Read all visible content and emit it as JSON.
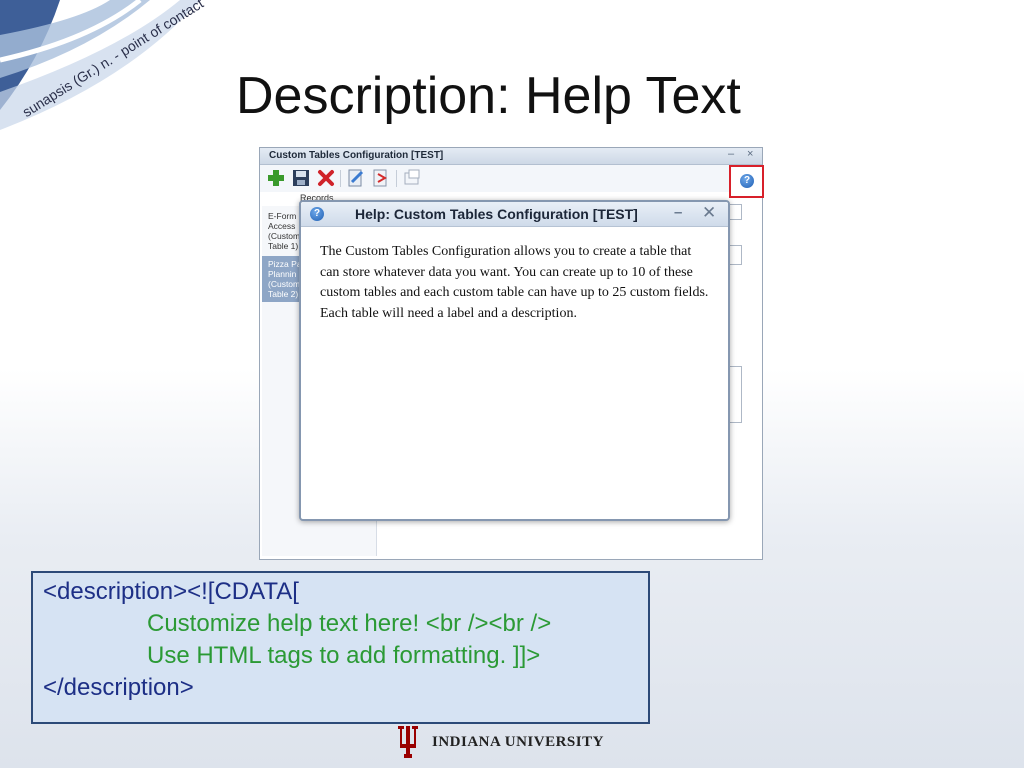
{
  "branding": {
    "tagline": "sunapsis (Gr.) n. - point of contact",
    "footer": "INDIANA UNIVERSITY",
    "footer_color": "#990000"
  },
  "slide": {
    "title": "Description: Help Text"
  },
  "app_window": {
    "title": "Custom Tables Configuration [TEST]",
    "minimize_glyph": "‒",
    "close_glyph": "×",
    "records_label": "Records",
    "toolbar_icons": [
      "add-icon",
      "save-icon",
      "delete-icon",
      "edit-icon",
      "export-icon",
      "window-icon"
    ],
    "help_icon": "?",
    "sidebar_items": [
      {
        "label": "E-Form\nAccess\n(Custom\nTable 1)",
        "selected": false
      },
      {
        "label": "Pizza Pa\nPlannin\n(Custom\nTable 2)",
        "selected": true
      }
    ]
  },
  "help_dialog": {
    "icon": "?",
    "title": "Help: Custom Tables Configuration [TEST]",
    "minimize_glyph": "–",
    "close_glyph": "✕",
    "body": "The Custom Tables Configuration allows you to create a table that can store whatever data you want. You can create up to 10 of these custom tables and each custom table can have up to 25 custom fields. Each table will need a label and a description."
  },
  "code_box": {
    "line1_tag": "<description>",
    "line1_rest": "<![CDATA[",
    "line2": "Customize help text here! <br /><br />",
    "line3": "Use HTML tags to add formatting. ]]>",
    "line4": "</description>"
  }
}
